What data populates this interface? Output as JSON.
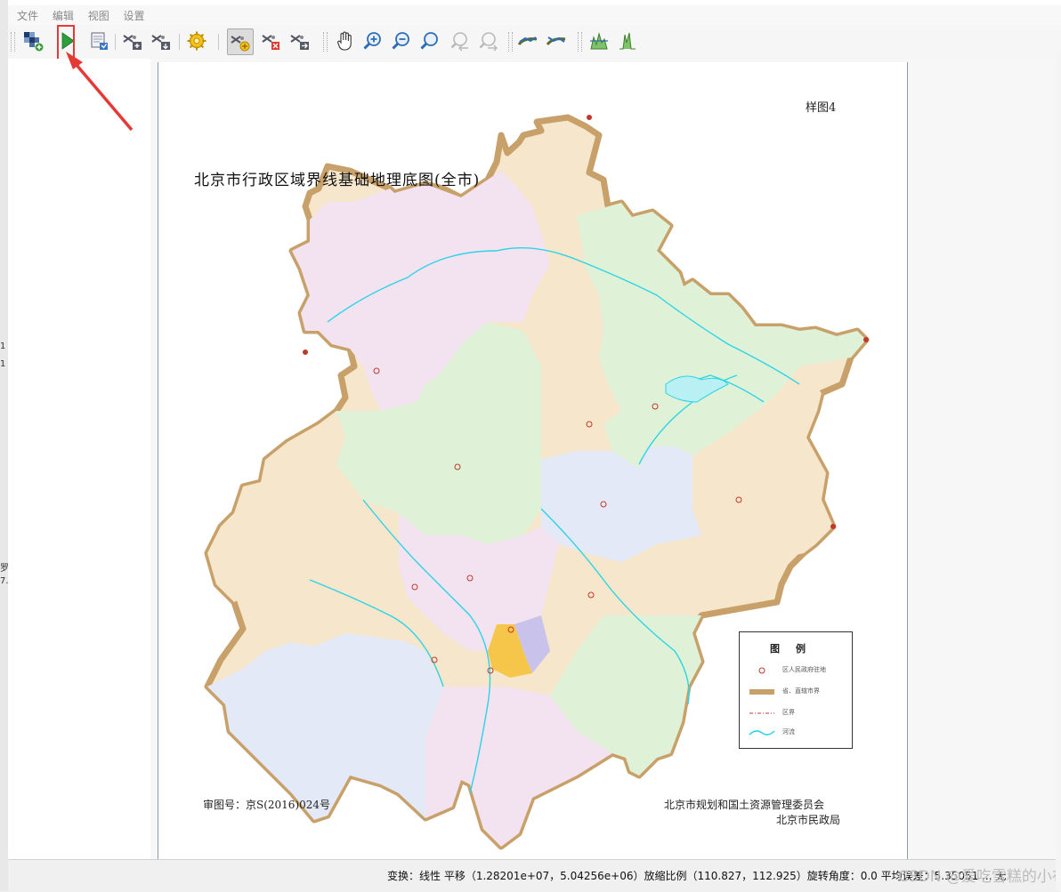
{
  "menu": [
    "文件",
    "编辑",
    "视图",
    "设置"
  ],
  "toolbar": {
    "buttons": [
      "add-raster-icon",
      "run-icon",
      "export-icon",
      "add-gcp-icon",
      "save-gcp-icon",
      "settings-icon",
      "move-gcp-icon",
      "delete-gcp-icon",
      "add-point-icon",
      "pan-icon",
      "zoom-in-icon",
      "zoom-out-icon",
      "zoom-layer-icon",
      "zoom-last-icon",
      "zoom-next-icon",
      "link-georef-icon",
      "link-qgis-icon",
      "full-histogram-icon",
      "local-histogram-icon"
    ],
    "highlighted": "run-icon"
  },
  "map": {
    "sample_no": "样图4",
    "title": "北京市行政区域界线基础地理底图(全市)",
    "approval": "审图号：京S(2016)024号",
    "publisher_1": "北京市规划和国土资源管理委员会",
    "publisher_2": "北京市民政局",
    "legend": {
      "title": "图例",
      "items": [
        "区人民政府驻地",
        "省、直辖市界",
        "区界",
        "河流"
      ]
    },
    "colors": {
      "boundary": "#c8a06a",
      "river": "#2bd4e6",
      "label": "#c0392b"
    }
  },
  "status": {
    "text": "变换：线性 平移（1.28201e+07，5.04256e+06）放缩比例（110.827，112.925）旋转角度：0.0 平均误差：5.35051 ... 无",
    "watermark": "CSDN @爱吃雪糕的小布丁"
  },
  "left_fragments": [
    "1",
    "1",
    "罗",
    "7."
  ],
  "annotation": {
    "color": "#e53935"
  }
}
